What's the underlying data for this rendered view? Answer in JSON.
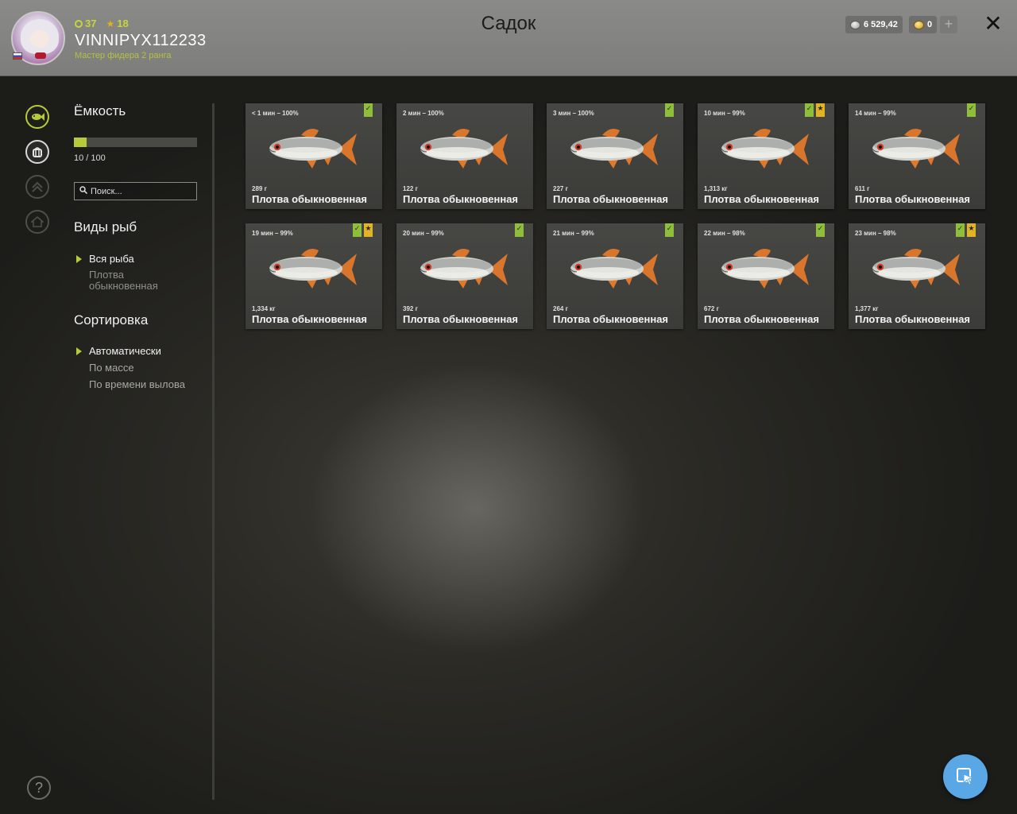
{
  "header": {
    "title": "Садок",
    "level": "37",
    "stars": "18",
    "username": "VINNIPYX112233",
    "rank": "Мастер фидера 2 ранга",
    "silver": "6 529,42",
    "gold": "0",
    "plus": "+",
    "close": "✕"
  },
  "filters": {
    "capacity_title": "Ёмкость",
    "capacity_value": "10 / 100",
    "capacity_fraction": 0.1,
    "search_placeholder": "Поиск...",
    "species_title": "Виды рыб",
    "species_all": "Вся рыба",
    "species_item": "Плотва обыкновенная",
    "sort_title": "Сортировка",
    "sort_auto": "Автоматически",
    "sort_mass": "По массе",
    "sort_time": "По времени вылова"
  },
  "help": "?",
  "colors": {
    "accent": "#b8c93a",
    "check_badge": "#8fbf3a",
    "star_badge": "#e2b322",
    "cursor_button": "#5aa7e6"
  },
  "fish": [
    {
      "time": "< 1 мин – 100%",
      "weight": "289 г",
      "name": "Плотва обыкновенная",
      "check": true,
      "star": false
    },
    {
      "time": "2 мин – 100%",
      "weight": "122 г",
      "name": "Плотва обыкновенная",
      "check": false,
      "star": false
    },
    {
      "time": "3 мин – 100%",
      "weight": "227 г",
      "name": "Плотва обыкновенная",
      "check": true,
      "star": false
    },
    {
      "time": "10 мин – 99%",
      "weight": "1,313 кг",
      "name": "Плотва обыкновенная",
      "check": true,
      "star": true
    },
    {
      "time": "14 мин – 99%",
      "weight": "611 г",
      "name": "Плотва обыкновенная",
      "check": true,
      "star": false
    },
    {
      "time": "19 мин – 99%",
      "weight": "1,334 кг",
      "name": "Плотва обыкновенная",
      "check": true,
      "star": true
    },
    {
      "time": "20 мин – 99%",
      "weight": "392 г",
      "name": "Плотва обыкновенная",
      "check": true,
      "star": false
    },
    {
      "time": "21 мин – 99%",
      "weight": "264 г",
      "name": "Плотва обыкновенная",
      "check": true,
      "star": false
    },
    {
      "time": "22 мин – 98%",
      "weight": "672 г",
      "name": "Плотва обыкновенная",
      "check": true,
      "star": false
    },
    {
      "time": "23 мин – 98%",
      "weight": "1,377 кг",
      "name": "Плотва обыкновенная",
      "check": true,
      "star": true
    }
  ]
}
